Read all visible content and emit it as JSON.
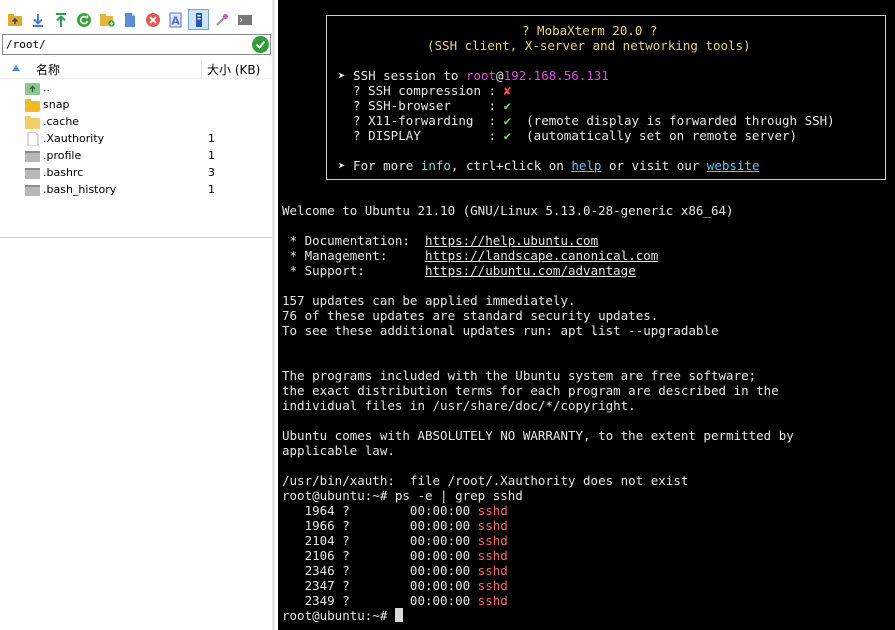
{
  "toolbar": {
    "buttons": [
      {
        "name": "go-parent-icon",
        "color": "#e0a92b"
      },
      {
        "name": "download-icon",
        "color": "#4a7fcf"
      },
      {
        "name": "upload-icon",
        "color": "#2f9c52"
      },
      {
        "name": "refresh-icon",
        "color": "#3aa43a"
      },
      {
        "name": "new-folder-icon",
        "color": "#e5b53c"
      },
      {
        "name": "new-file-icon",
        "color": "#5a8fd6"
      },
      {
        "name": "delete-icon",
        "color": "#e05a5a"
      },
      {
        "name": "rename-icon",
        "color": "#5b6ed6"
      },
      {
        "name": "toggle-hidden-icon",
        "color": "#2a55a8"
      },
      {
        "name": "follow-terminal-icon",
        "color": "#c95fb8"
      },
      {
        "name": "terminal-icon",
        "color": "#777777"
      }
    ]
  },
  "path_bar": {
    "value": "/root/"
  },
  "file_list": {
    "columns": {
      "name": "名称",
      "size": "大小 (KB)"
    },
    "items": [
      {
        "name": "..",
        "size": "",
        "icon": "parent-folder-icon"
      },
      {
        "name": "snap",
        "size": "",
        "icon": "folder-icon"
      },
      {
        "name": ".cache",
        "size": "",
        "icon": "folder-icon"
      },
      {
        "name": ".Xauthority",
        "size": "1",
        "icon": "file-icon"
      },
      {
        "name": ".profile",
        "size": "1",
        "icon": "script-file-icon"
      },
      {
        "name": ".bashrc",
        "size": "3",
        "icon": "script-file-icon"
      },
      {
        "name": ".bash_history",
        "size": "1",
        "icon": "script-file-icon"
      }
    ]
  },
  "terminal": {
    "banner": {
      "title": "? MobaXterm 20.0 ?",
      "subtitle": "(SSH client, X-server and networking tools)",
      "session_prefix": "➤ SSH session to ",
      "user": "root",
      "at": "@",
      "host": "192.168.56.131",
      "features": [
        {
          "label": "  ? SSH compression : ",
          "mark": "✘",
          "note": ""
        },
        {
          "label": "  ? SSH-browser     : ",
          "mark": "✔",
          "note": ""
        },
        {
          "label": "  ? X11-forwarding  : ",
          "mark": "✔",
          "note": "  (remote display is forwarded through SSH)"
        },
        {
          "label": "  ? DISPLAY         : ",
          "mark": "✔",
          "note": "  (automatically set on remote server)"
        }
      ],
      "more_prefix": "➤ For more ",
      "more_info": "info",
      "more_mid": ", ctrl+click on ",
      "more_help": "help",
      "more_or": " or visit our ",
      "more_site": "website"
    },
    "motd": {
      "welcome": "Welcome to Ubuntu 21.10 (GNU/Linux 5.13.0-28-generic x86_64)",
      "links": [
        {
          "label": " * Documentation:  ",
          "url": "https://help.ubuntu.com"
        },
        {
          "label": " * Management:     ",
          "url": "https://landscape.canonical.com"
        },
        {
          "label": " * Support:        ",
          "url": "https://ubuntu.com/advantage"
        }
      ],
      "updates": [
        "157 updates can be applied immediately.",
        "76 of these updates are standard security updates.",
        "To see these additional updates run: apt list --upgradable"
      ],
      "license": [
        "The programs included with the Ubuntu system are free software;",
        "the exact distribution terms for each program are described in the",
        "individual files in /usr/share/doc/*/copyright."
      ],
      "warranty": [
        "Ubuntu comes with ABSOLUTELY NO WARRANTY, to the extent permitted by",
        "applicable law."
      ],
      "xauth": "/usr/bin/xauth:  file /root/.Xauthority does not exist"
    },
    "prompt": "root@ubuntu:~# ",
    "command": "ps -e | grep sshd",
    "processes": [
      {
        "pid": "   1964 ?        00:00:00 ",
        "cmd": "sshd"
      },
      {
        "pid": "   1966 ?        00:00:00 ",
        "cmd": "sshd"
      },
      {
        "pid": "   2104 ?        00:00:00 ",
        "cmd": "sshd"
      },
      {
        "pid": "   2106 ?        00:00:00 ",
        "cmd": "sshd"
      },
      {
        "pid": "   2346 ?        00:00:00 ",
        "cmd": "sshd"
      },
      {
        "pid": "   2347 ?        00:00:00 ",
        "cmd": "sshd"
      },
      {
        "pid": "   2349 ?        00:00:00 ",
        "cmd": "sshd"
      }
    ],
    "final_prompt": "root@ubuntu:~# "
  }
}
